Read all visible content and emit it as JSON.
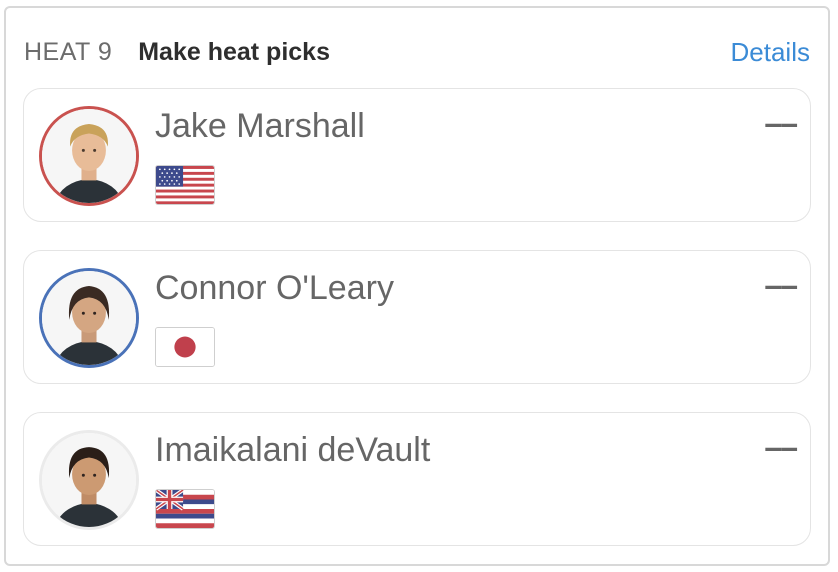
{
  "header": {
    "heat_label": "HEAT 9",
    "subtitle": "Make heat picks",
    "details_link": "Details"
  },
  "surfers": [
    {
      "name": "Jake Marshall",
      "flag_icon": "usa-flag-icon",
      "ring_color": "#c9524f",
      "score": "––"
    },
    {
      "name": "Connor O'Leary",
      "flag_icon": "japan-flag-icon",
      "ring_color": "#4a72b8",
      "score": "––"
    },
    {
      "name": "Imaikalani deVault",
      "flag_icon": "hawaii-flag-icon",
      "ring_color": "#ebebeb",
      "score": "––"
    }
  ],
  "colors": {
    "accent_link": "#3b8bd6",
    "red_ring": "#c9524f",
    "blue_ring": "#4a72b8"
  }
}
